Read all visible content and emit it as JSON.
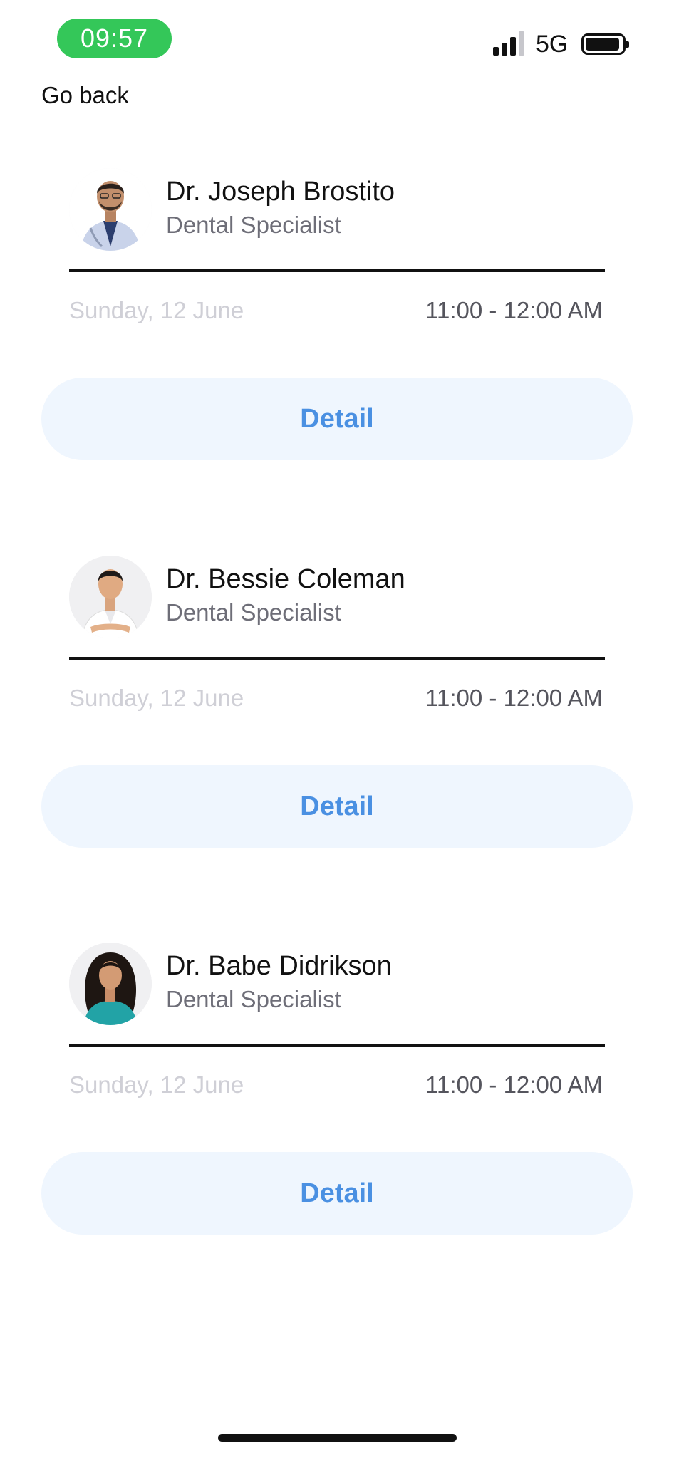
{
  "status_bar": {
    "time": "09:57",
    "network": "5G",
    "icons": [
      "signal-icon",
      "battery-icon"
    ]
  },
  "nav": {
    "back_label": "Go back"
  },
  "appointments": [
    {
      "name": "Dr. Joseph Brostito",
      "specialty": "Dental Specialist",
      "date": "Sunday, 12 June",
      "time": "11:00 - 12:00 AM",
      "button_label": "Detail"
    },
    {
      "name": "Dr. Bessie Coleman",
      "specialty": "Dental Specialist",
      "date": "Sunday, 12 June",
      "time": "11:00 - 12:00 AM",
      "button_label": "Detail"
    },
    {
      "name": "Dr. Babe Didrikson",
      "specialty": "Dental Specialist",
      "date": "Sunday, 12 June",
      "time": "11:00 - 12:00 AM",
      "button_label": "Detail"
    }
  ],
  "colors": {
    "time_pill": "#34c759",
    "button_bg": "#eff6fe",
    "button_text": "#4a90e2",
    "date_text": "#cfcfd6",
    "specialty_text": "#6e6e78"
  }
}
